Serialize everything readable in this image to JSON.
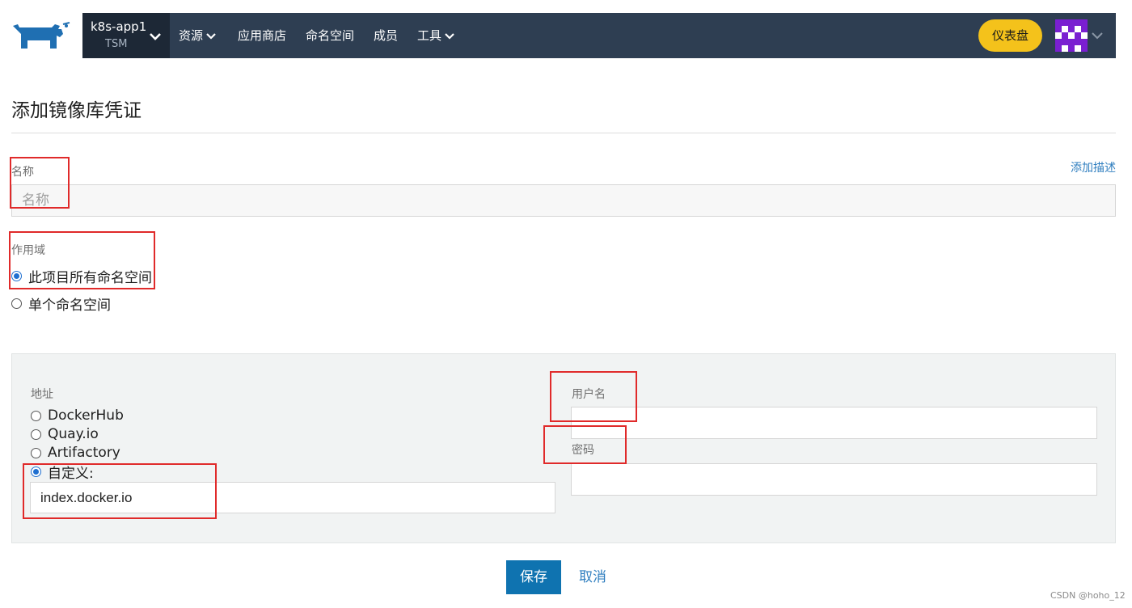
{
  "header": {
    "cluster_name": "k8s-app1",
    "project_name": "TSM",
    "nav": [
      {
        "label": "资源",
        "has_dropdown": true
      },
      {
        "label": "应用商店",
        "has_dropdown": false
      },
      {
        "label": "命名空间",
        "has_dropdown": false
      },
      {
        "label": "成员",
        "has_dropdown": false
      },
      {
        "label": "工具",
        "has_dropdown": true
      }
    ],
    "dashboard_label": "仪表盘"
  },
  "page": {
    "title": "添加镜像库凭证"
  },
  "form": {
    "name_label": "名称",
    "name_placeholder": "名称",
    "name_value": "",
    "add_description_link": "添加描述",
    "scope_label": "作用域",
    "scope_options": [
      {
        "label": "此项目所有命名空间",
        "checked": true
      },
      {
        "label": "单个命名空间",
        "checked": false
      }
    ],
    "address_label": "地址",
    "address_options": [
      {
        "label": "DockerHub",
        "checked": false
      },
      {
        "label": "Quay.io",
        "checked": false
      },
      {
        "label": "Artifactory",
        "checked": false
      },
      {
        "label": "自定义:",
        "checked": true
      }
    ],
    "custom_address_value": "index.docker.io",
    "username_label": "用户名",
    "username_value": "",
    "password_label": "密码",
    "password_value": ""
  },
  "actions": {
    "save_label": "保存",
    "cancel_label": "取消"
  },
  "watermark": "CSDN @hoho_12",
  "colors": {
    "topbar": "#2e3e52",
    "cluster_bg": "#1d2836",
    "dashboard_button": "#f4c21b",
    "primary_button": "#0f73b0",
    "link": "#2f7ebf",
    "annotation_box": "#e02a2a",
    "logo": "#1f6fb2",
    "avatar": "#7a1fd1"
  },
  "icons": {
    "logo": "rancher-cow-logo",
    "nav_dropdown": "chevron-down-icon",
    "avatar": "identicon-avatar"
  }
}
